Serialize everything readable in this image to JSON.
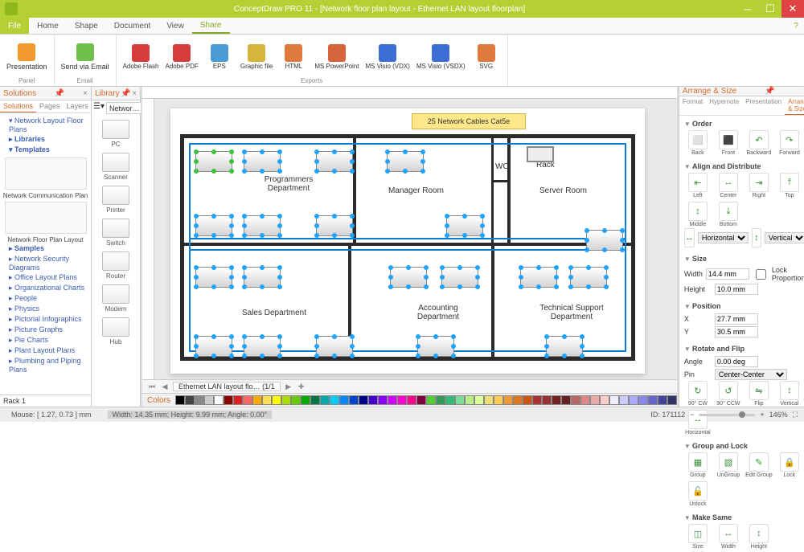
{
  "title": "ConceptDraw PRO 11 - [Network floor plan layout - Ethernet LAN layout floorplan]",
  "menu": {
    "file": "File",
    "tabs": [
      "Home",
      "Shape",
      "Document",
      "View",
      "Share"
    ],
    "active": "Share"
  },
  "ribbon": {
    "panel": {
      "items": [
        {
          "l": "Presentation",
          "c": "#f29a2e"
        }
      ],
      "lbl": "Panel"
    },
    "email": {
      "items": [
        {
          "l": "Send via Email",
          "c": "#6ebf4b"
        }
      ],
      "lbl": "Email"
    },
    "exports": {
      "items": [
        {
          "l": "Adobe Flash",
          "c": "#d63c3c"
        },
        {
          "l": "Adobe PDF",
          "c": "#d63c3c"
        },
        {
          "l": "EPS",
          "c": "#4b9bd6"
        },
        {
          "l": "Graphic file",
          "c": "#d6b53c"
        },
        {
          "l": "HTML",
          "c": "#e07a3c"
        },
        {
          "l": "MS PowerPoint",
          "c": "#d6643c"
        },
        {
          "l": "MS Visio (VDX)",
          "c": "#3c6ed6"
        },
        {
          "l": "MS Visio (VSDX)",
          "c": "#3c6ed6"
        },
        {
          "l": "SVG",
          "c": "#e07a3c"
        }
      ],
      "lbl": "Exports"
    }
  },
  "solutions": {
    "title": "Solutions",
    "tabs": [
      "Solutions",
      "Pages",
      "Layers"
    ],
    "nlfp": "Network Layout Floor Plans",
    "libs": "Libraries",
    "tmpl": "Templates",
    "t1": "Network Communication Plan",
    "t2": "Network Floor Plan Layout",
    "samples": "Samples",
    "links": [
      "Network Security Diagrams",
      "Office Layout Plans",
      "Organizational Charts",
      "People",
      "Physics",
      "Pictorial Infographics",
      "Picture Graphs",
      "Pie Charts",
      "Plant Layout Plans",
      "Plumbing and Piping Plans"
    ],
    "rack": "Rack 1"
  },
  "library": {
    "title": "Library",
    "search": "Networ…",
    "items": [
      "PC",
      "Scanner",
      "Printer",
      "Switch",
      "Router",
      "Modem",
      "Hub"
    ]
  },
  "canvas": {
    "callout": "25 Network Cables Cat5e",
    "rooms": {
      "pd": "Programmers Department",
      "mr": "Manager Room",
      "wc": "WC",
      "rack": "Rack",
      "sr": "Server Room",
      "sd": "Sales Department",
      "ad": "Accounting Department",
      "tsd": "Technical Support Department"
    },
    "sheet": "Ethernet LAN layout flo…",
    "sheetpg": "(1/1"
  },
  "colors": {
    "title": "Colors"
  },
  "props": {
    "title": "Arrange & Size",
    "tabs": [
      "Format",
      "Hypernote",
      "Presentation",
      "Arrange & Size"
    ],
    "order": {
      "h": "Order",
      "b": [
        "Back",
        "Front",
        "Backward",
        "Forward"
      ]
    },
    "align": {
      "h": "Align and Distribute",
      "h1": [
        "Left",
        "Center",
        "Right"
      ],
      "h2": [
        "Top",
        "Middle",
        "Bottom"
      ],
      "horiz": "Horizontal",
      "vert": "Vertical"
    },
    "size": {
      "h": "Size",
      "w": "Width",
      "wv": "14.4 mm",
      "he": "Height",
      "hv": "10.0 mm",
      "lock": "Lock Proportions"
    },
    "pos": {
      "h": "Position",
      "x": "X",
      "xv": "27.7 mm",
      "y": "Y",
      "yv": "30.5 mm"
    },
    "rot": {
      "h": "Rotate and Flip",
      "a": "Angle",
      "av": "0.00 deg",
      "p": "Pin",
      "pv": "Center-Center",
      "b": [
        "90° CW",
        "90° CCW",
        "Flip"
      ],
      "vh": [
        "Vertical",
        "Horizontal"
      ]
    },
    "grp": {
      "h": "Group and Lock",
      "b": [
        "Group",
        "UnGroup",
        "Edit Group"
      ],
      "b2": [
        "Lock",
        "Unlock"
      ]
    },
    "ms": {
      "h": "Make Same",
      "b": [
        "Size",
        "Width",
        "Height"
      ]
    }
  },
  "status": {
    "mouse": "Mouse: [ 1.27, 0.73 ] mm",
    "dims": "Width: 14.35 mm;  Height: 9.99 mm;  Angle: 0.00°",
    "id": "ID: 171112",
    "zoom": "146%"
  }
}
